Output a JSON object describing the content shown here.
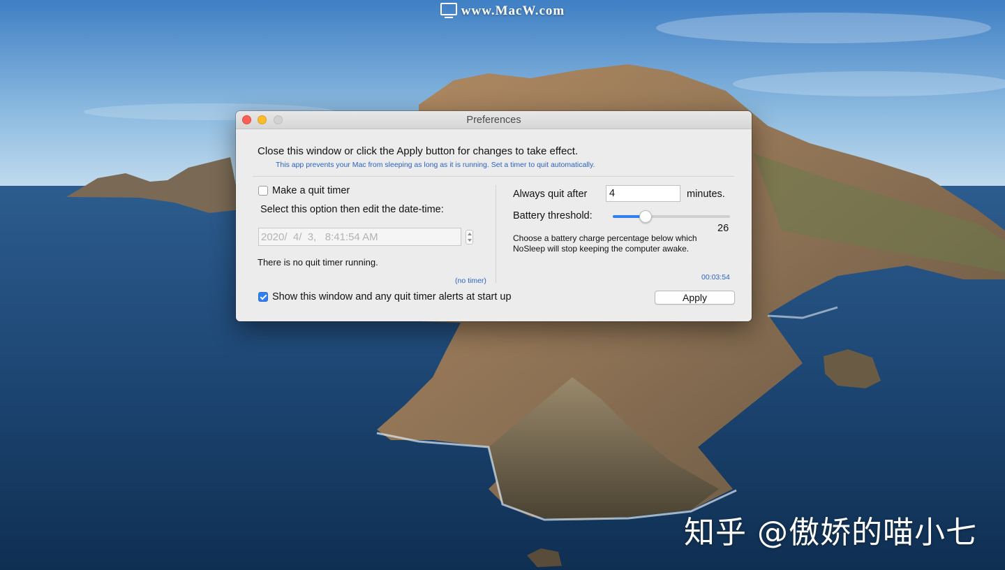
{
  "watermarks": {
    "top": "www.MacW.com",
    "bottom": "知乎 @傲娇的喵小七"
  },
  "window": {
    "title": "Preferences",
    "main_message": "Close this window or click the Apply button for changes to take effect.",
    "sub_message": "This app prevents your Mac from sleeping as long as it is running. Set a timer to quit automatically."
  },
  "quit_timer": {
    "checkbox_label": "Make a quit timer",
    "checked": false,
    "instructions": "Select this option then edit the date-time:",
    "date_time": "2020/  4/  3,   8:41:54 AM",
    "status": "There is no quit timer running.",
    "timer_status": "(no timer)"
  },
  "always_quit": {
    "label": "Always quit after",
    "value": "4",
    "unit": "minutes."
  },
  "battery": {
    "label": "Battery threshold:",
    "value": "26",
    "slider_fraction": 0.28,
    "help_line1": "Choose a battery charge percentage below which",
    "help_line2": "NoSleep will stop keeping the computer awake."
  },
  "elapsed_time": "00:03:54",
  "startup": {
    "label": "Show this window and any quit timer alerts at start up",
    "checked": true
  },
  "apply_label": "Apply",
  "colors": {
    "accent": "#2f7ff0",
    "link_blue": "#2a62c8",
    "close": "#fc5f57",
    "minimize": "#fdbc2e",
    "zoom_inactive": "#d2d2d2"
  }
}
